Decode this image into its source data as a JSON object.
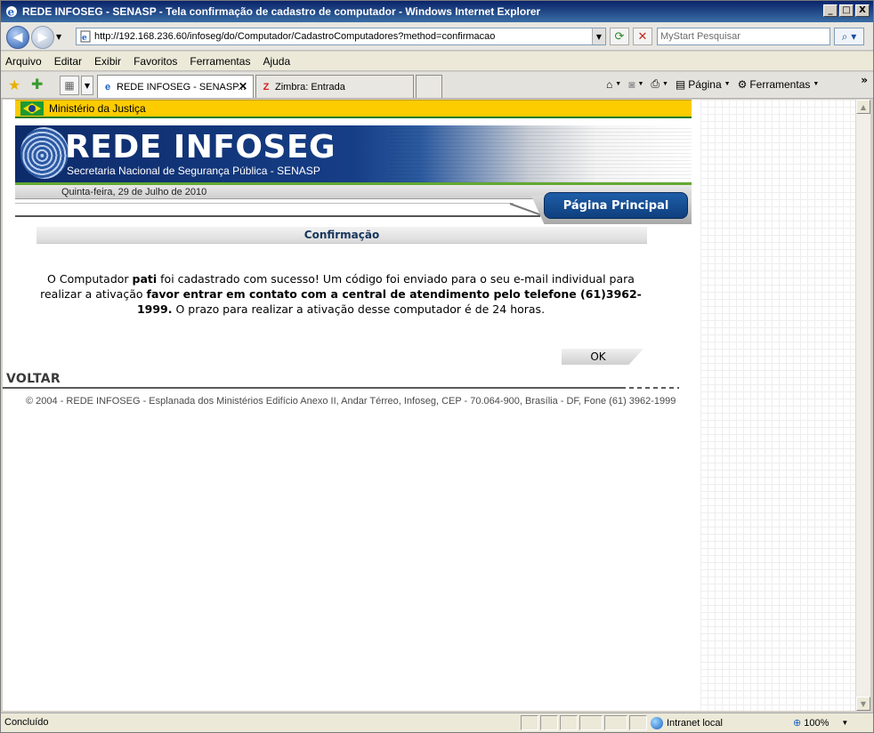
{
  "window": {
    "title": "REDE INFOSEG - SENASP - Tela confirmação de cadastro de computador - Windows Internet Explorer",
    "minimize": "_",
    "maximize": "□",
    "close": "X"
  },
  "address": {
    "url": "http://192.168.236.60/infoseg/do/Computador/CadastroComputadores?method=confirmacao",
    "search_placeholder": "MyStart Pesquisar"
  },
  "menu": [
    "Arquivo",
    "Editar",
    "Exibir",
    "Favoritos",
    "Ferramentas",
    "Ajuda"
  ],
  "tabs": {
    "active": "REDE INFOSEG - SENASP...",
    "other": "Zimbra: Entrada"
  },
  "commands": {
    "page": "Página",
    "tools": "Ferramentas"
  },
  "site": {
    "ministry": "Ministério da Justiça",
    "logo": "REDE INFOSEG",
    "subtitle": "Secretaria Nacional de Segurança Pública - SENASP",
    "date": "Quinta-feira, 29 de Julho de 2010",
    "home_button": "Página Principal",
    "section_title": "Confirmação",
    "msg": {
      "p1": "O Computador ",
      "name": "pati",
      "p2": " foi cadastrado com sucesso! Um código foi enviado para o seu e-mail individual para realizar a ativação ",
      "bold": "favor entrar em contato com a central de atendimento pelo telefone (61)3962-1999.",
      "p3": " O prazo para realizar a ativação desse computador é de 24 horas."
    },
    "ok_button": "OK",
    "back": "VOLTAR",
    "copyright": "© 2004 - REDE INFOSEG - Esplanada dos Ministérios Edifício Anexo II, Andar Térreo, Infoseg, CEP - 70.064-900, Brasília - DF, Fone (61) 3962-1999"
  },
  "status": {
    "text": "Concluído",
    "zone": "Intranet local",
    "zoom": "100%"
  }
}
